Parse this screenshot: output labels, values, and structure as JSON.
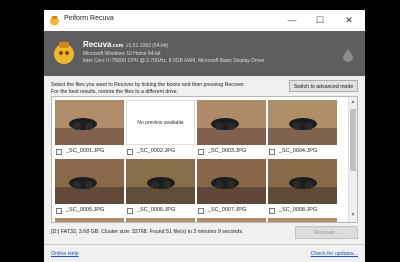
{
  "window": {
    "title": "Piriform Recuva"
  },
  "header": {
    "title": "Recuva",
    "domain": ".com",
    "version": "v1.51.1063 (64-bit)",
    "line1": "Microsoft Windows 10 Home 64-bit",
    "line2": "Intel Core i7-7500U CPU @ 2.70GHz, 8.0GB RAM, Microsoft Basic Display Driver"
  },
  "instructions": {
    "line1": "Select the files you want to Recover by ticking the boxes and then pressing Recover.",
    "line2": "For the best results, restore the files to a different drive."
  },
  "advanced_button": "Switch to advanced mode",
  "files": [
    {
      "name": "_SC_0001.JPG",
      "preview": "photo"
    },
    {
      "name": "_SC_0002.JPG",
      "preview": "none",
      "no_preview_text": "No preview available"
    },
    {
      "name": "_SC_0003.JPG",
      "preview": "photo"
    },
    {
      "name": "_SC_0004.JPG",
      "preview": "photo"
    },
    {
      "name": "_SC_0005.JPG",
      "preview": "photo"
    },
    {
      "name": "_SC_0006.JPG",
      "preview": "photo"
    },
    {
      "name": "_SC_0007.JPG",
      "preview": "photo"
    },
    {
      "name": "_SC_0008.JPG",
      "preview": "photo"
    }
  ],
  "status": "[D:] FAT32, 3.68 GB. Cluster size: 32768. Found 51 file(s) in 3 minutes 9 seconds.",
  "recover_button": "Recover...",
  "footer": {
    "help": "Online Help",
    "updates": "Check for updates..."
  },
  "colors": {
    "header_bg": "#5e5e5e",
    "link": "#1a55c8"
  }
}
